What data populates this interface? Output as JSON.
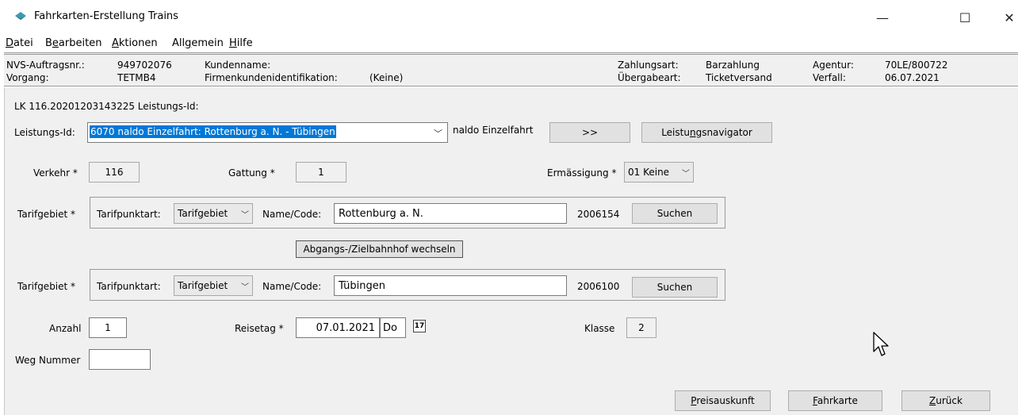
{
  "window": {
    "title": "Fahrkarten-Erstellung Trains",
    "minimize": "—",
    "maximize": "☐",
    "close": "✕"
  },
  "menu": [
    {
      "pre": "",
      "u": "D",
      "post": "atei"
    },
    {
      "pre": "B",
      "u": "e",
      "post": "arbeiten"
    },
    {
      "pre": "",
      "u": "A",
      "post": "ktionen"
    },
    {
      "pre": "All",
      "u": "g",
      "post": "emein"
    },
    {
      "pre": "",
      "u": "H",
      "post": "ilfe"
    }
  ],
  "info": {
    "auftrag_label": "NVS-Auftragsnr.:",
    "auftrag_value": "949702076",
    "vorgang_label": "Vorgang:",
    "vorgang_value": "TETMB4",
    "kunde_label": "Kundenname:",
    "firmen_label": "Firmenkundenidentifikation:",
    "firmen_value": "(Keine)",
    "zahlung_label": "Zahlungsart:",
    "zahlung_value": "Barzahlung",
    "uebergabe_label": "Übergabeart:",
    "uebergabe_value": "Ticketversand",
    "agentur_label": "Agentur:",
    "agentur_value": "70LE/800722",
    "verfall_label": "Verfall:",
    "verfall_value": "06.07.2021"
  },
  "form": {
    "header": "LK 116.20201203143225 Leistungs-Id:",
    "leistung_label": "Leistungs-Id:",
    "leistung_value": "6070 naldo Einzelfahrt: Rottenburg a. N. - Tübingen",
    "leistung_name": "naldo Einzelfahrt",
    "more_btn": ">>",
    "navigator_btn": "Leistungsnavigator",
    "verkehr_label": "Verkehr *",
    "verkehr_value": "116",
    "gattung_label": "Gattung *",
    "gattung_value": "1",
    "ermaessigung_label": "Ermässigung *",
    "ermaessigung_value": "01 Keine",
    "tarif1": {
      "label": "Tarifgebiet *",
      "punktart_label": "Tarifpunktart:",
      "punktart_value": "Tarifgebiet",
      "name_label": "Name/Code:",
      "name_value": "Rottenburg a. N.",
      "code": "2006154",
      "search": "Suchen"
    },
    "swap_btn": "Abgangs-/Zielbahnhof wechseln",
    "tarif2": {
      "label": "Tarifgebiet *",
      "punktart_label": "Tarifpunktart:",
      "punktart_value": "Tarifgebiet",
      "name_label": "Name/Code:",
      "name_value": "Tübingen",
      "code": "2006100",
      "search": "Suchen"
    },
    "anzahl_label": "Anzahl",
    "anzahl_value": "1",
    "reisetag_label": "Reisetag *",
    "reisetag_value": "07.01.2021",
    "wochentag": "Do",
    "calendar_num": "17",
    "klasse_label": "Klasse",
    "klasse_value": "2",
    "weg_label": "Weg Nummer",
    "weg_value": ""
  },
  "buttons": {
    "preis": {
      "u": "P",
      "rest": "reisauskunft"
    },
    "fahrkarte": {
      "u": "F",
      "rest": "ahrkarte"
    },
    "zurueck": {
      "u": "Z",
      "rest": "urück"
    }
  },
  "colors": {
    "panel": "#f0f0f0",
    "selection": "#0078d7",
    "icon_teal": "#3a9ab0"
  }
}
